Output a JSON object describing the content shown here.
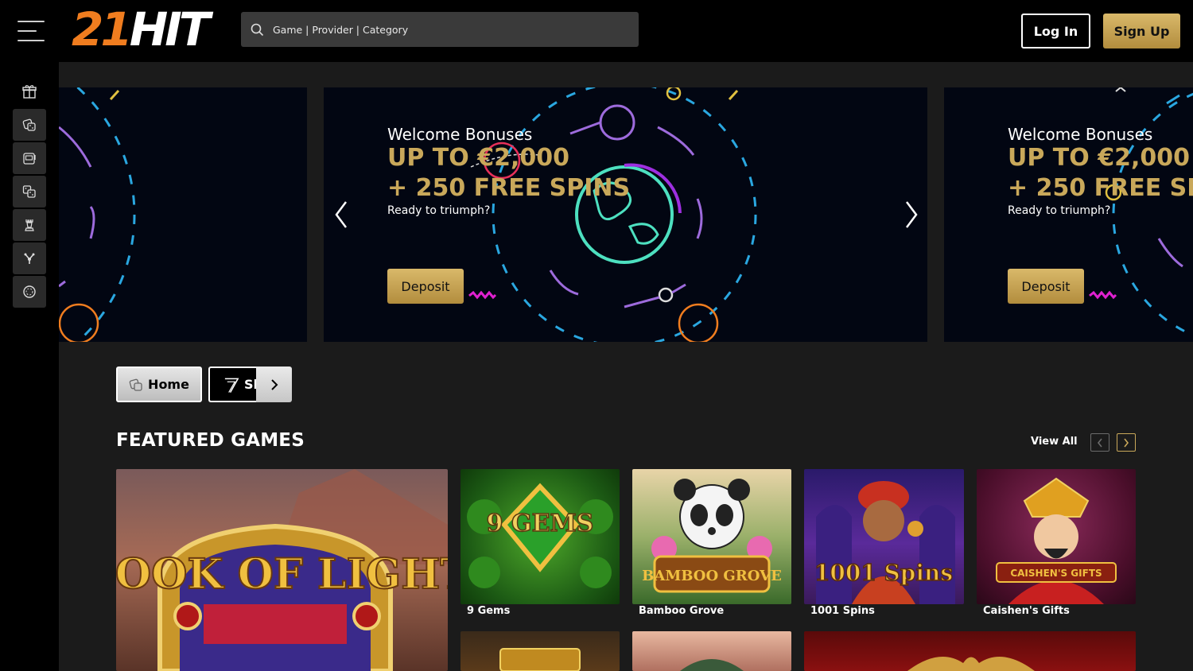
{
  "header": {
    "logo_num": "21",
    "logo_text": "HIT",
    "search_placeholder": "Game | Provider | Category",
    "login_label": "Log In",
    "signup_label": "Sign Up"
  },
  "sidebar": {
    "icons": [
      "gift-icon",
      "dice-icon",
      "slot-machine-icon",
      "dice-pair-icon",
      "chess-piece-icon",
      "cards-icon",
      "chip-icon"
    ]
  },
  "carousel": {
    "slides": [
      {
        "title": "Welcome Bonuses",
        "line1": "UP TO €2,000",
        "line2": "+ 250 FREE SPINS",
        "subtitle": "Ready to triumph?",
        "button": "Deposit"
      },
      {
        "title": "Welcome Bonuses",
        "line1": "UP TO €2,000",
        "line2": "+ 250 FREE SP",
        "subtitle": "Ready to triumph?",
        "button": "Deposit"
      }
    ]
  },
  "categories": {
    "home_label": "Home",
    "slots_label": "Sl"
  },
  "featured": {
    "title": "FEATURED GAMES",
    "view_all": "View All",
    "games": [
      {
        "name": "Book of Light",
        "art": "BOOK OF LIGHT"
      },
      {
        "name": "9 Gems",
        "art": "9 GEMS"
      },
      {
        "name": "Bamboo Grove",
        "art": "BAMBOO GROVE"
      },
      {
        "name": "1001 Spins",
        "art": "1001 Spins"
      },
      {
        "name": "Caishen's Gifts",
        "art": "CAISHEN'S GIFTS"
      }
    ]
  },
  "colors": {
    "gold": "#c9a85a",
    "orange": "#f07d1f",
    "background": "#1b1b1b"
  }
}
